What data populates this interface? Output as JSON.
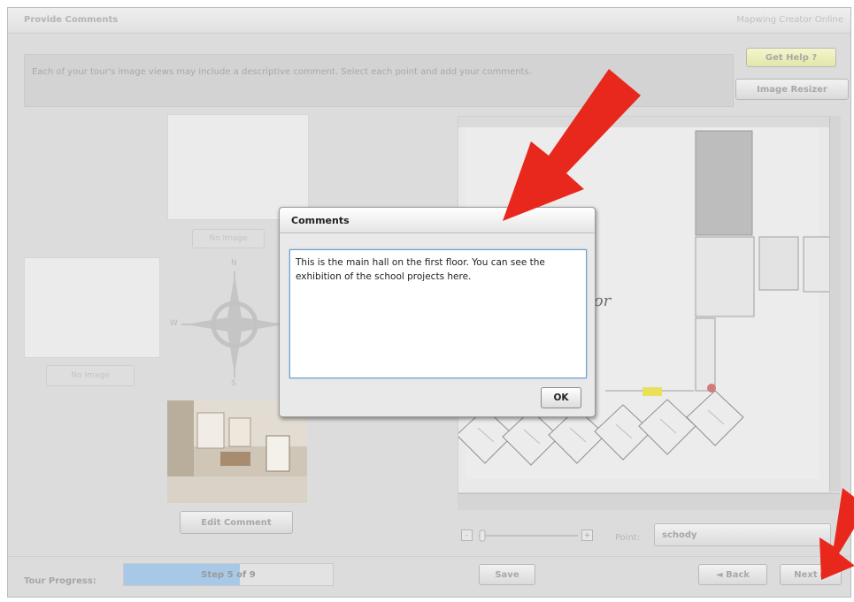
{
  "window": {
    "title": "Provide Comments",
    "brand": "Mapwing Creator Online"
  },
  "instructions": "Each of your tour's image views may include a descriptive comment. Select each point and add your comments.",
  "header_buttons": {
    "help": "Get Help ?",
    "resizer": "Image Resizer"
  },
  "views": {
    "no_image_top": "No Image",
    "no_image_left": "No Image",
    "edit_comment": "Edit Comment"
  },
  "compass": {
    "n": "N",
    "w": "W",
    "s": "S"
  },
  "dialog": {
    "title": "Comments",
    "comment": "This is the main hall on the first floor. You can see the exhibition of the school projects here.",
    "ok": "OK"
  },
  "map": {
    "floor_text": "oor",
    "zoom_minus": "-",
    "zoom_plus": "+",
    "point_label": "Point:",
    "point_value": "schody"
  },
  "footer": {
    "progress_label": "Tour Progress:",
    "progress_text": "Step 5 of 9",
    "progress_fraction": 0.556,
    "save": "Save",
    "back": "◄ Back",
    "next": "Next ►"
  },
  "colors": {
    "annotation_arrow": "#e8281c",
    "progress_fill": "#a7c9e7"
  }
}
